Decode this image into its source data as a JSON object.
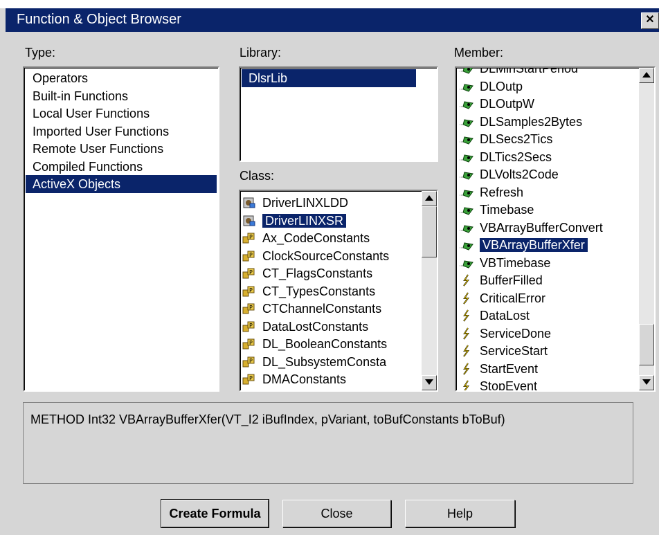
{
  "window": {
    "title": "Function & Object Browser",
    "close_label": "✕"
  },
  "type": {
    "label": "Type:",
    "items": [
      "Operators",
      "Built-in Functions",
      "Local User Functions",
      "Imported User Functions",
      "Remote User Functions",
      "Compiled Functions",
      "ActiveX Objects"
    ],
    "selected": 6
  },
  "library": {
    "label": "Library:",
    "items": [
      "DlsrLib"
    ],
    "selected": 0
  },
  "class": {
    "label": "Class:",
    "items": [
      {
        "text": "DriverLINXLDD",
        "icon": "class-object-icon"
      },
      {
        "text": "DriverLINXSR",
        "icon": "class-object-icon"
      },
      {
        "text": "Ax_CodeConstants",
        "icon": "constants-icon"
      },
      {
        "text": "ClockSourceConstants",
        "icon": "constants-icon"
      },
      {
        "text": "CT_FlagsConstants",
        "icon": "constants-icon"
      },
      {
        "text": "CT_TypesConstants",
        "icon": "constants-icon"
      },
      {
        "text": "CTChannelConstants",
        "icon": "constants-icon"
      },
      {
        "text": "DataLostConstants",
        "icon": "constants-icon"
      },
      {
        "text": "DL_BooleanConstants",
        "icon": "constants-icon"
      },
      {
        "text": "DL_SubsystemConsta",
        "icon": "constants-icon"
      },
      {
        "text": "DMAConstants",
        "icon": "constants-icon"
      }
    ],
    "selected": 1
  },
  "member": {
    "label": "Member:",
    "items": [
      {
        "text": "DLMinStartPeriod",
        "icon": "method-icon"
      },
      {
        "text": "DLOutp",
        "icon": "method-icon"
      },
      {
        "text": "DLOutpW",
        "icon": "method-icon"
      },
      {
        "text": "DLSamples2Bytes",
        "icon": "method-icon"
      },
      {
        "text": "DLSecs2Tics",
        "icon": "method-icon"
      },
      {
        "text": "DLTics2Secs",
        "icon": "method-icon"
      },
      {
        "text": "DLVolts2Code",
        "icon": "method-icon"
      },
      {
        "text": "Refresh",
        "icon": "method-icon"
      },
      {
        "text": "Timebase",
        "icon": "method-icon"
      },
      {
        "text": "VBArrayBufferConvert",
        "icon": "method-icon"
      },
      {
        "text": "VBArrayBufferXfer",
        "icon": "method-icon"
      },
      {
        "text": "VBTimebase",
        "icon": "method-icon"
      },
      {
        "text": "BufferFilled",
        "icon": "event-icon"
      },
      {
        "text": "CriticalError",
        "icon": "event-icon"
      },
      {
        "text": "DataLost",
        "icon": "event-icon"
      },
      {
        "text": "ServiceDone",
        "icon": "event-icon"
      },
      {
        "text": "ServiceStart",
        "icon": "event-icon"
      },
      {
        "text": "StartEvent",
        "icon": "event-icon"
      },
      {
        "text": "StopEvent",
        "icon": "event-icon"
      }
    ],
    "selected": 10
  },
  "description": "METHOD Int32 VBArrayBufferXfer(VT_I2 iBufIndex, pVariant, toBufConstants bToBuf)",
  "buttons": {
    "create": "Create Formula",
    "close": "Close",
    "help": "Help"
  },
  "colors": {
    "selection": "#0a246a",
    "face": "#d6d6d6"
  }
}
